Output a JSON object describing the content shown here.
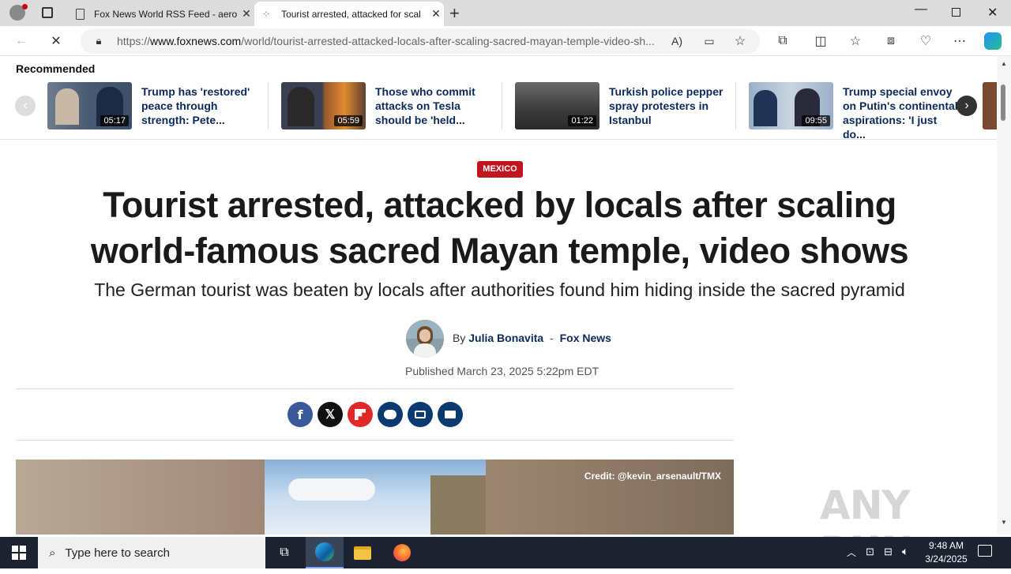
{
  "browser": {
    "tabs": [
      {
        "title": "Fox News World RSS Feed - aero"
      },
      {
        "title": "Tourist arrested, attacked for scal"
      }
    ],
    "url_prefix": "https://",
    "url_domain": "www.foxnews.com",
    "url_path": "/world/tourist-arrested-attacked-locals-after-scaling-sacred-mayan-temple-video-sh..."
  },
  "recommended": {
    "label": "Recommended",
    "items": [
      {
        "duration": "05:17",
        "title": "Trump has 'restored' peace through strength: Pete..."
      },
      {
        "duration": "05:59",
        "title": "Those who commit attacks on Tesla should be 'held..."
      },
      {
        "duration": "01:22",
        "title": "Turkish police pepper spray protesters in Istanbul"
      },
      {
        "duration": "09:55",
        "title": "Trump special envoy on Putin's continental aspirations: 'I just do..."
      }
    ]
  },
  "article": {
    "category": "MEXICO",
    "headline": "Tourist arrested, attacked by locals after scaling world-famous sacred Mayan temple, video shows",
    "subheadline": "The German tourist was beaten by locals after authorities found him hiding inside the sacred pyramid",
    "by": "By",
    "author": "Julia Bonavita",
    "separator": "-",
    "outlet": "Fox News",
    "published": "Published March 23, 2025 5:22pm EDT",
    "image_credit": "Credit: @kevin_arsenault/TMX"
  },
  "share_colors": {
    "facebook": "#3b5998",
    "x": "#111111",
    "flipboard": "#e12828",
    "comments": "#0a3a70",
    "print": "#0a3a70",
    "email": "#0a3a70"
  },
  "watermark": "ANY RUN",
  "taskbar": {
    "search_placeholder": "Type here to search",
    "time": "9:48 AM",
    "date": "3/24/2025"
  }
}
